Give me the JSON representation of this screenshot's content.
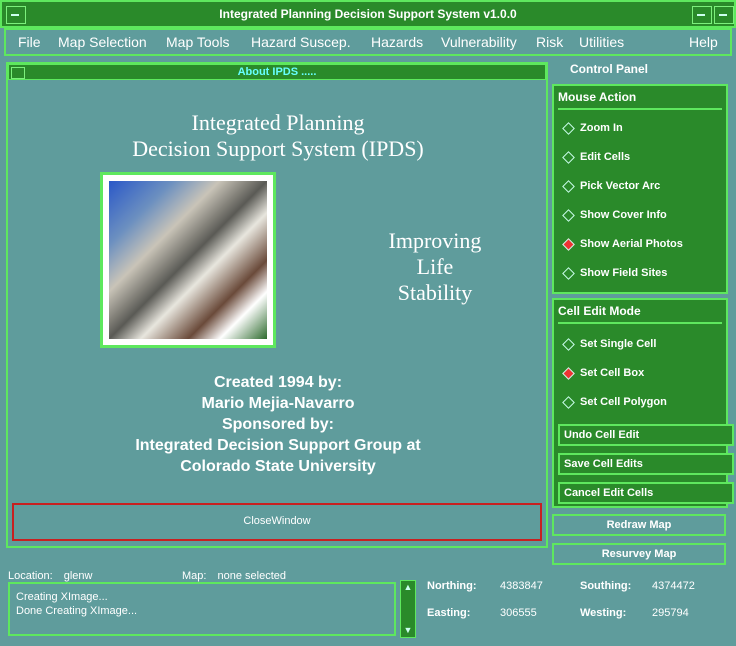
{
  "window": {
    "title": "Integrated Planning Decision Support System v1.0.0"
  },
  "menu": [
    "File",
    "Map Selection",
    "Map Tools",
    "Hazard Suscep.",
    "Hazards",
    "Vulnerability",
    "Risk",
    "Utilities",
    "Help"
  ],
  "dialog": {
    "title": "About IPDS .....",
    "heading_line1": "Integrated Planning",
    "heading_line2": "Decision Support System (IPDS)",
    "slogan1": "Improving",
    "slogan2": "Life",
    "slogan3": "Stability",
    "credit1": "Created 1994 by:",
    "credit2": "Mario Mejia-Navarro",
    "credit3": "Sponsored by:",
    "credit4": "Integrated Decision Support Group at",
    "credit5": "Colorado State University",
    "close_label": "CloseWindow"
  },
  "control_panel": {
    "title": "Control Panel",
    "mouse_action": {
      "label": "Mouse Action",
      "options": [
        "Zoom In",
        "Edit Cells",
        "Pick Vector Arc",
        "Show Cover Info",
        "Show Aerial Photos",
        "Show Field Sites"
      ],
      "selected": "Show Aerial Photos"
    },
    "cell_edit": {
      "label": "Cell Edit Mode",
      "options": [
        "Set Single Cell",
        "Set Cell Box",
        "Set Cell Polygon"
      ],
      "selected": "Set Cell Box",
      "undo": "Undo Cell Edit",
      "save": "Save Cell Edits",
      "cancel": "Cancel Edit Cells"
    },
    "redraw": "Redraw Map",
    "resurvey": "Resurvey Map"
  },
  "status": {
    "location_label": "Location:",
    "location_value": "glenw",
    "map_label": "Map:",
    "map_value": "none selected",
    "messages": [
      "Creating XImage...",
      "Done Creating XImage..."
    ]
  },
  "coords": {
    "northing_label": "Northing:",
    "northing": "4383847",
    "southing_label": "Southing:",
    "southing": "4374472",
    "easting_label": "Easting:",
    "easting": "306555",
    "westing_label": "Westing:",
    "westing": "295794"
  },
  "colors": {
    "panel_green": "#2a8a2a",
    "border_green": "#5ee85e",
    "teal": "#5f9c9c",
    "selected": "#e33333"
  }
}
